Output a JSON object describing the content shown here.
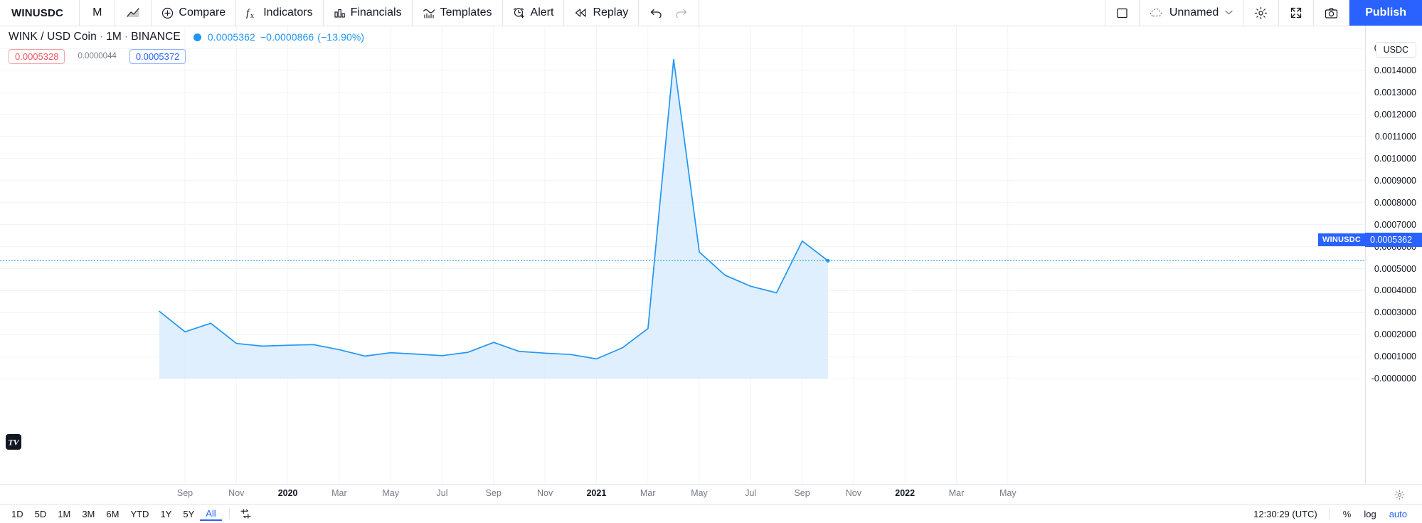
{
  "toolbar": {
    "symbol": "WINUSDC",
    "interval": "M",
    "chart_style_icon": "area-chart-icon",
    "compare": "Compare",
    "indicators": "Indicators",
    "financials": "Financials",
    "templates": "Templates",
    "alert": "Alert",
    "replay": "Replay",
    "undo_icon": "undo-icon",
    "redo_icon": "redo-icon",
    "layout_icon": "layout-square-icon",
    "layout_name": "Unnamed",
    "chevron": "⌄",
    "settings_icon": "gear-icon",
    "fullscreen_icon": "fullscreen-icon",
    "snapshot_icon": "camera-icon",
    "publish": "Publish"
  },
  "legend": {
    "title": "WINK / USD Coin",
    "interval": "1M",
    "exchange": "BINANCE",
    "sep": "·",
    "last_price": "0.0005362",
    "change_abs": "−0.0000866",
    "change_pct": "(−13.90%)",
    "ohlc": {
      "open": "0.0005328",
      "volume": "0.0000044",
      "close": "0.0005372"
    }
  },
  "price_scale": {
    "currency_pill": "USDC",
    "current_price": "0.0005362",
    "current_symbol": "WINUSDC",
    "labels": [
      "0.0015000",
      "0.0014000",
      "0.0013000",
      "0.0012000",
      "0.0011000",
      "0.0010000",
      "0.0009000",
      "0.0008000",
      "0.0007000",
      "0.0006000",
      "0.0005000",
      "0.0004000",
      "0.0003000",
      "0.0002000",
      "0.0001000",
      "-0.0000000"
    ]
  },
  "time_scale": {
    "labels": [
      {
        "text": "Sep",
        "bold": false
      },
      {
        "text": "Nov",
        "bold": false
      },
      {
        "text": "2020",
        "bold": true
      },
      {
        "text": "Mar",
        "bold": false
      },
      {
        "text": "May",
        "bold": false
      },
      {
        "text": "Jul",
        "bold": false
      },
      {
        "text": "Sep",
        "bold": false
      },
      {
        "text": "Nov",
        "bold": false
      },
      {
        "text": "2021",
        "bold": true
      },
      {
        "text": "Mar",
        "bold": false
      },
      {
        "text": "May",
        "bold": false
      },
      {
        "text": "Jul",
        "bold": false
      },
      {
        "text": "Sep",
        "bold": false
      },
      {
        "text": "Nov",
        "bold": false
      },
      {
        "text": "2022",
        "bold": true
      },
      {
        "text": "Mar",
        "bold": false
      },
      {
        "text": "May",
        "bold": false
      }
    ]
  },
  "bottom_bar": {
    "ranges": [
      "1D",
      "5D",
      "1M",
      "3M",
      "6M",
      "YTD",
      "1Y",
      "5Y",
      "All"
    ],
    "active_range": "All",
    "calendar_icon": "date-range-icon",
    "clock": "12:30:29 (UTC)",
    "percent": "%",
    "log": "log",
    "auto": "auto"
  },
  "colors": {
    "accent": "#2962ff",
    "line": "#2196f3",
    "area_fill": "#d6eaff",
    "grid": "#f0f3fa",
    "text": "#131722",
    "muted": "#787b86",
    "down": "#f7525f"
  },
  "chart_data": {
    "type": "area",
    "title": "WINK / USD Coin · 1M · BINANCE",
    "xlabel": "",
    "ylabel": "USDC",
    "ylim": [
      -0.0,
      0.0015
    ],
    "grid": true,
    "legend": "none",
    "x": [
      "Jul 2019",
      "Aug 2019",
      "Sep 2019",
      "Oct 2019",
      "Nov 2019",
      "Dec 2019",
      "2020-01",
      "Feb 2020",
      "Mar 2020",
      "Apr 2020",
      "May 2020",
      "Jun 2020",
      "Jul 2020",
      "Aug 2020",
      "Sep 2020",
      "Oct 2020",
      "Nov 2020",
      "Dec 2020",
      "2021-01",
      "Feb 2021",
      "Mar 2021",
      "Apr 2021",
      "May 2021",
      "Jun 2021",
      "Jul 2021",
      "Aug 2021",
      "Sep 2021"
    ],
    "series": [
      {
        "name": "WINUSDC",
        "values": [
          0.000306,
          0.000213,
          0.000252,
          0.00016,
          0.000148,
          0.000152,
          0.000155,
          0.000132,
          0.000103,
          0.000118,
          0.000112,
          0.000105,
          0.00012,
          0.000165,
          0.000124,
          0.000116,
          0.00011,
          9e-05,
          0.00014,
          0.000228,
          0.00145,
          0.000575,
          0.00047,
          0.00042,
          0.00039,
          0.000625,
          0.000536
        ]
      }
    ],
    "last_value": 0.0005362,
    "change_abs": -8.66e-05,
    "change_pct": -13.9
  }
}
